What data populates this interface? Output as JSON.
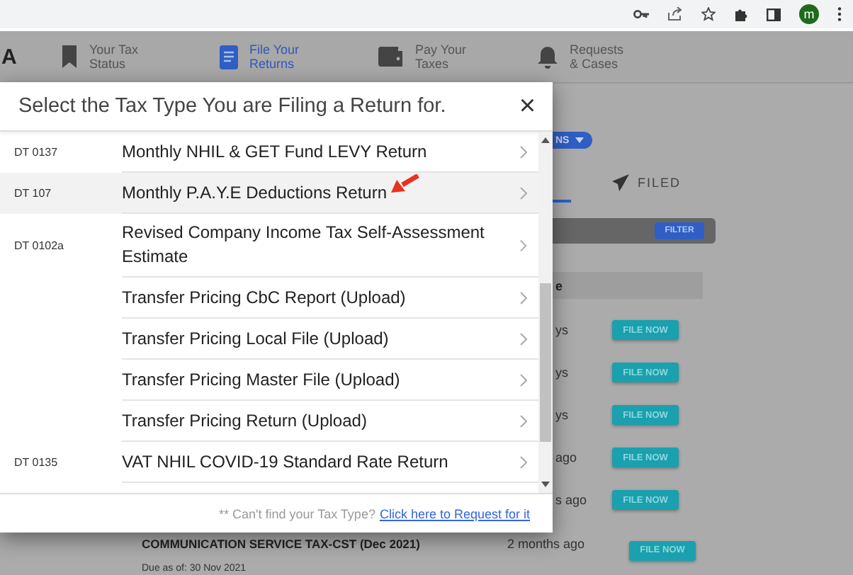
{
  "browser_toolbar": {
    "avatar_initial": "m"
  },
  "nav": {
    "logo_fragment": "A",
    "items": [
      {
        "label_lines": [
          "Your Tax",
          "Status"
        ],
        "selected": false
      },
      {
        "label_lines": [
          "File Your",
          "Returns"
        ],
        "selected": true
      },
      {
        "label_lines": [
          "Pay Your",
          "Taxes"
        ],
        "selected": false
      },
      {
        "label_lines": [
          "Requests",
          "& Cases"
        ],
        "selected": false
      }
    ]
  },
  "page": {
    "actions_button": {
      "label": "NS"
    },
    "tabs": [
      {
        "selected": true
      },
      {
        "label": "FILED",
        "selected": false
      }
    ],
    "filter_button": "FILTER",
    "table_header_fragment": "e",
    "rows": [
      {
        "due_fragment": "ys",
        "action": "FILE NOW"
      },
      {
        "due_fragment": "ys",
        "action": "FILE NOW"
      },
      {
        "due_fragment": "ys",
        "action": "FILE NOW"
      },
      {
        "due_fragment": "ago",
        "action": "FILE NOW"
      },
      {
        "due_fragment": "s ago",
        "action": "FILE NOW"
      }
    ],
    "last_row": {
      "title": "COMMUNICATION SERVICE TAX-CST (Dec 2021)",
      "due_date": "Due as of: 30 Nov 2021",
      "age": "2 months ago",
      "action": "FILE NOW"
    }
  },
  "modal": {
    "title": "Select the Tax Type You are Filing a Return for.",
    "close": "×",
    "items": [
      {
        "code": "DT 0137",
        "name": "Monthly NHIL & GET Fund LEVY Return",
        "selected": false
      },
      {
        "code": "DT 107",
        "name": "Monthly P.A.Y.E Deductions Return",
        "selected": true,
        "annotated": true
      },
      {
        "code": "DT 0102a",
        "name": "Revised Company Income Tax Self-Assessment Estimate",
        "selected": false
      },
      {
        "name": "Transfer Pricing CbC Report (Upload)",
        "selected": false
      },
      {
        "name": "Transfer Pricing Local File (Upload)",
        "selected": false
      },
      {
        "name": "Transfer Pricing Master File (Upload)",
        "selected": false
      },
      {
        "name": "Transfer Pricing Return (Upload)",
        "selected": false
      },
      {
        "code": "DT 0135",
        "name": "VAT NHIL COVID-19 Standard Rate Return",
        "selected": false
      }
    ],
    "footer": {
      "note": "** Can't find your Tax Type?",
      "link": "Click here to Request for it"
    }
  }
}
